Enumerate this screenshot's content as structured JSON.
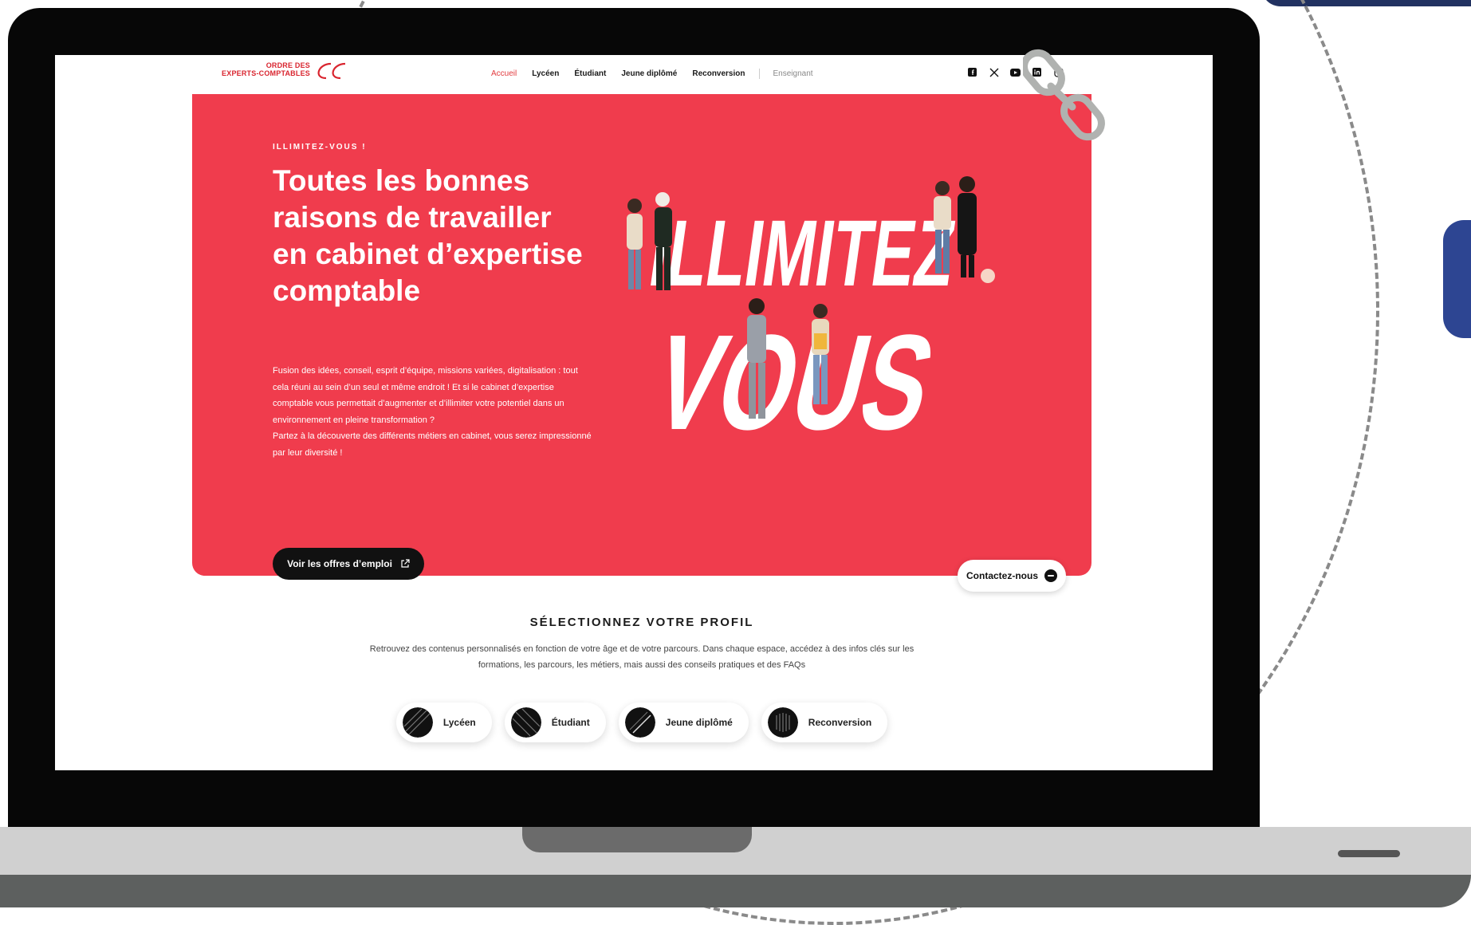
{
  "colors": {
    "brand_red": "#f03c4d",
    "nav_active": "#e23b3f",
    "profile_bg": "#e4e6f1",
    "deco_navy": "#223261"
  },
  "logo": {
    "line1": "ORDRE DES",
    "line2": "EXPERTS-COMPTABLES"
  },
  "nav": {
    "items": [
      {
        "label": "Accueil",
        "active": true
      },
      {
        "label": "Lycéen"
      },
      {
        "label": "Étudiant"
      },
      {
        "label": "Jeune diplômé"
      },
      {
        "label": "Reconversion"
      }
    ],
    "teacher": "Enseignant",
    "socials": [
      "facebook-icon",
      "x-icon",
      "youtube-icon",
      "linkedin-icon",
      "instagram-icon"
    ]
  },
  "hero": {
    "eyebrow": "ILLIMITEZ-VOUS !",
    "title": "Toutes les bonnes raisons de travailler en cabinet d’expertise comptable",
    "paragraph1": "Fusion des idées, conseil, esprit d’équipe, missions variées, digitalisation : tout cela réuni au sein d’un seul et même endroit ! Et si le cabinet d’expertise comptable vous permettait d’augmenter et d’illimiter votre potentiel dans un environnement en pleine transformation ?",
    "paragraph2": "Partez à la découverte des différents métiers en cabinet, vous serez impressionné par leur diversité !",
    "cta": "Voir les offres d’emploi",
    "art_line1": "ILLIMITEZ",
    "art_line2": "VOUS"
  },
  "contact": {
    "label": "Contactez-nous"
  },
  "profile": {
    "title": "SÉLECTIONNEZ VOTRE PROFIL",
    "description": "Retrouvez des contenus personnalisés en fonction de votre âge et de votre parcours. Dans chaque espace, accédez à des infos clés sur les formations, les parcours, les métiers, mais aussi des conseils pratiques et des FAQs",
    "chips": [
      {
        "label": "Lycéen"
      },
      {
        "label": "Étudiant"
      },
      {
        "label": "Jeune diplômé"
      },
      {
        "label": "Reconversion"
      }
    ]
  }
}
